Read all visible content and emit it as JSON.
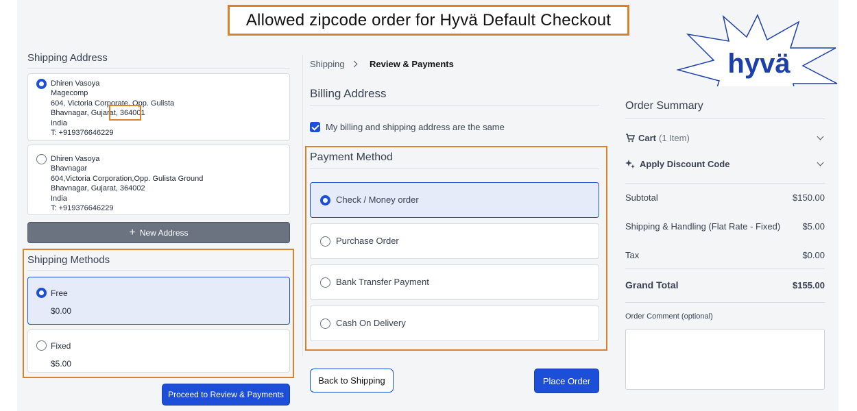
{
  "banner": {
    "text": "Allowed zipcode order for Hyvä Default Checkout"
  },
  "logo": {
    "text": "hyvä"
  },
  "shipping_address": {
    "title": "Shipping Address",
    "addresses": [
      {
        "selected": true,
        "lines": [
          "Dhiren Vasoya",
          "Magecomp",
          "604, Victoria Corporate, Opp. Gulista",
          "Bhavnagar, Gujarat, 364001",
          "India",
          "T: +919376646229"
        ]
      },
      {
        "selected": false,
        "lines": [
          "Dhiren Vasoya",
          "Bhavnagar",
          "604,Victoria Corporation,Opp. Gulista Ground",
          "Bhavnagar, Gujarat, 364002",
          "India",
          "T: +919376646229"
        ]
      }
    ],
    "new_address_label": "New Address"
  },
  "shipping_methods": {
    "title": "Shipping Methods",
    "options": [
      {
        "name": "Free",
        "price": "$0.00",
        "selected": true
      },
      {
        "name": "Fixed",
        "price": "$5.00",
        "selected": false
      }
    ],
    "proceed_label": "Proceed to Review & Payments"
  },
  "breadcrumb": {
    "step1": "Shipping",
    "step2": "Review & Payments"
  },
  "billing": {
    "title": "Billing Address",
    "same_label": "My billing and shipping address are the same",
    "same_checked": true
  },
  "payment": {
    "title": "Payment Method",
    "options": [
      {
        "label": "Check / Money order",
        "selected": true
      },
      {
        "label": "Purchase Order",
        "selected": false
      },
      {
        "label": "Bank Transfer Payment",
        "selected": false
      },
      {
        "label": "Cash On Delivery",
        "selected": false
      }
    ]
  },
  "actions": {
    "back_label": "Back to Shipping",
    "place_label": "Place Order"
  },
  "summary": {
    "title": "Order Summary",
    "cart_label": "Cart",
    "cart_count": "(1 Item)",
    "discount_label": "Apply Discount Code",
    "subtotal_label": "Subtotal",
    "subtotal_value": "$150.00",
    "shipping_label": "Shipping & Handling (Flat Rate - Fixed)",
    "shipping_value": "$5.00",
    "tax_label": "Tax",
    "tax_value": "$0.00",
    "grand_label": "Grand Total",
    "grand_value": "$155.00",
    "comment_label": "Order Comment (optional)"
  },
  "colors": {
    "accent": "#1d4ed8",
    "highlight": "#d9822b",
    "logo": "#1d3fa8"
  }
}
